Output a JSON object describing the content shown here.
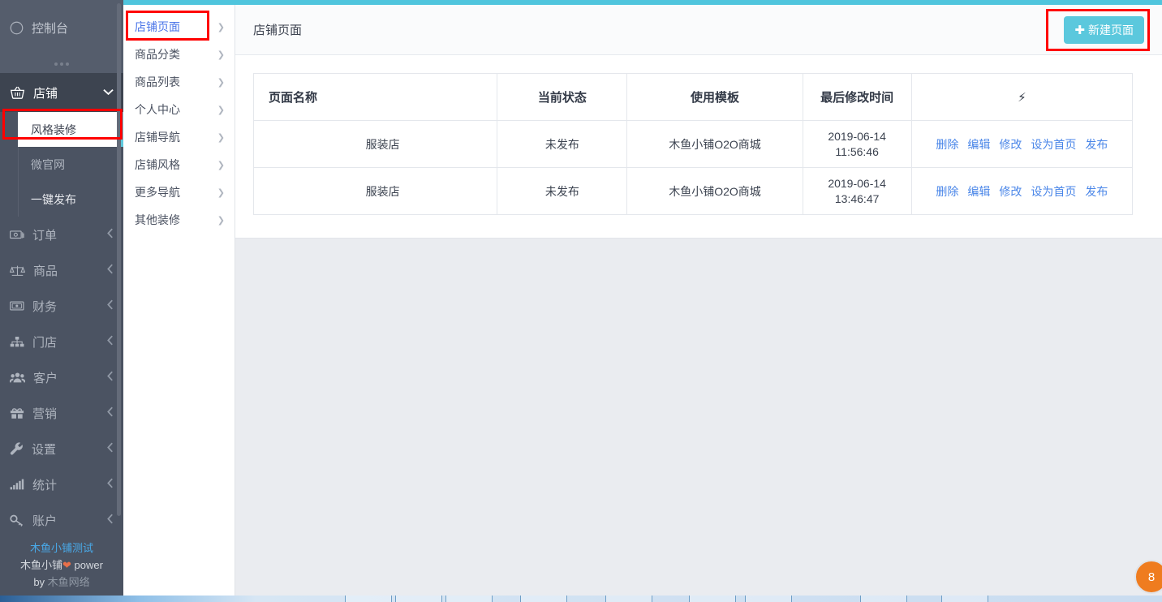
{
  "theme": {
    "accent_teal": "#5bc8dd",
    "sidebar_bg": "#4b5362",
    "link_blue": "#4a86e8",
    "annotation_red": "#ff0000",
    "page_bg": "#eaecf0"
  },
  "sidebar": {
    "dashboard": {
      "label": "控制台",
      "icon": "compass-icon"
    },
    "group": {
      "label": "店铺",
      "icon": "basket-icon",
      "chevron": "chevron-down-icon",
      "chevron_glyph": "❯"
    },
    "sub_items": [
      {
        "label": "风格装修",
        "selected": true
      },
      {
        "label": "微官网",
        "selected": false
      },
      {
        "label": "一键发布",
        "selected": false
      }
    ],
    "items": [
      {
        "label": "订单",
        "icon": "money-icon",
        "chevron": "chevron-left-icon"
      },
      {
        "label": "商品",
        "icon": "scales-icon",
        "chevron": "chevron-left-icon"
      },
      {
        "label": "财务",
        "icon": "banknote-icon",
        "chevron": "chevron-left-icon"
      },
      {
        "label": "门店",
        "icon": "sitemap-icon",
        "chevron": "chevron-left-icon"
      },
      {
        "label": "客户",
        "icon": "users-icon",
        "chevron": "chevron-left-icon"
      },
      {
        "label": "营销",
        "icon": "gift-icon",
        "chevron": "chevron-left-icon"
      },
      {
        "label": "设置",
        "icon": "wrench-icon",
        "chevron": "chevron-left-icon"
      },
      {
        "label": "统计",
        "icon": "bar-chart-icon",
        "chevron": "chevron-left-icon"
      },
      {
        "label": "账户",
        "icon": "key-icon",
        "chevron": "chevron-left-icon"
      }
    ],
    "footer": {
      "line1": "木鱼小铺测试",
      "line2_pre": "木鱼小铺",
      "line2_heart": "❤",
      "line2_post": " power",
      "line3_pre": "by ",
      "line3_post": "木鱼网络"
    }
  },
  "submenu": {
    "items": [
      {
        "label": "店铺页面",
        "active": true
      },
      {
        "label": "商品分类",
        "active": false
      },
      {
        "label": "商品列表",
        "active": false
      },
      {
        "label": "个人中心",
        "active": false
      },
      {
        "label": "店铺导航",
        "active": false
      },
      {
        "label": "店铺风格",
        "active": false
      },
      {
        "label": "更多导航",
        "active": false
      },
      {
        "label": "其他装修",
        "active": false
      }
    ],
    "chevron_glyph": "❯"
  },
  "main": {
    "header": {
      "title": "店铺页面",
      "new_button_label": "新建页面",
      "new_button_plus": "✚"
    },
    "table": {
      "headers": [
        "页面名称",
        "当前状态",
        "使用模板",
        "最后修改时间",
        "⚡"
      ],
      "rows": [
        {
          "name": "服装店",
          "status": "未发布",
          "template": "木鱼小铺O2O商城",
          "date": "2019-06-14",
          "time": "11:56:46",
          "actions": [
            "删除",
            "编辑",
            "修改",
            "设为首页",
            "发布"
          ]
        },
        {
          "name": "服装店",
          "status": "未发布",
          "template": "木鱼小铺O2O商城",
          "date": "2019-06-14",
          "time": "13:46:47",
          "actions": [
            "删除",
            "编辑",
            "修改",
            "设为首页",
            "发布"
          ]
        }
      ]
    }
  },
  "overlay": {
    "float_widget_label": "8"
  }
}
